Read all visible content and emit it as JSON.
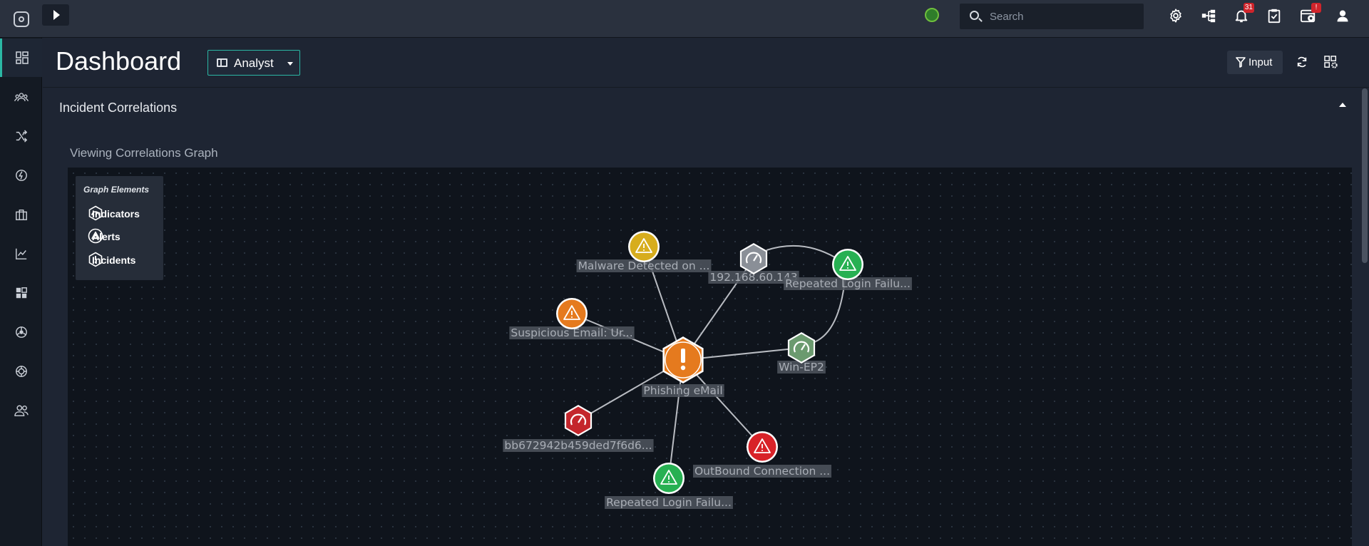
{
  "topbar": {
    "search_placeholder": "Search",
    "notifications_count": "31",
    "tasks_badge": "!",
    "icons": [
      "settings-icon",
      "hierarchy-icon",
      "bell-icon",
      "clipboard-check-icon",
      "gear-calendar-icon",
      "user-icon"
    ]
  },
  "sidebar": {
    "items": [
      "dashboard-icon",
      "investigations-icon",
      "playbooks-icon",
      "automation-icon",
      "marketplace-icon",
      "reports-icon",
      "widgets-icon",
      "integrations-icon",
      "threat-intel-icon",
      "users-icon"
    ]
  },
  "header": {
    "title": "Dashboard",
    "dashboard_select": "Analyst",
    "input_button": "Input"
  },
  "section": {
    "title": "Incident Correlations",
    "subtitle": "Viewing Correlations Graph"
  },
  "legend": {
    "title": "Graph Elements",
    "items": [
      "Indicators",
      "Alerts",
      "Incidents"
    ]
  },
  "graph": {
    "nodes": [
      {
        "id": "phishing",
        "label": "Phishing eMail",
        "kind": "incident",
        "color": "#e57a1e"
      },
      {
        "id": "malware",
        "label": "Malware Detected on ...",
        "kind": "alert",
        "color": "#d7ad1d"
      },
      {
        "id": "ip",
        "label": "192.168.60.143",
        "kind": "indicator",
        "color": "#8a8f97"
      },
      {
        "id": "login1",
        "label": "Repeated Login Failu...",
        "kind": "alert",
        "color": "#27b052"
      },
      {
        "id": "suspicious",
        "label": "Suspicious Email: Ur...",
        "kind": "alert",
        "color": "#e57a1e"
      },
      {
        "id": "winep2",
        "label": "Win-EP2",
        "kind": "indicator",
        "color": "#6b9a6f"
      },
      {
        "id": "hash",
        "label": "bb672942b459ded7f6d6...",
        "kind": "indicator",
        "color": "#c4262c"
      },
      {
        "id": "outbound",
        "label": "OutBound Connection ...",
        "kind": "alert",
        "color": "#d82228"
      },
      {
        "id": "login2",
        "label": "Repeated Login Failu...",
        "kind": "alert",
        "color": "#27b052"
      }
    ],
    "edges": [
      [
        "phishing",
        "malware"
      ],
      [
        "phishing",
        "ip"
      ],
      [
        "phishing",
        "suspicious"
      ],
      [
        "phishing",
        "winep2"
      ],
      [
        "phishing",
        "hash"
      ],
      [
        "phishing",
        "outbound"
      ],
      [
        "phishing",
        "login2"
      ],
      [
        "ip",
        "login1"
      ],
      [
        "login1",
        "winep2"
      ]
    ]
  }
}
